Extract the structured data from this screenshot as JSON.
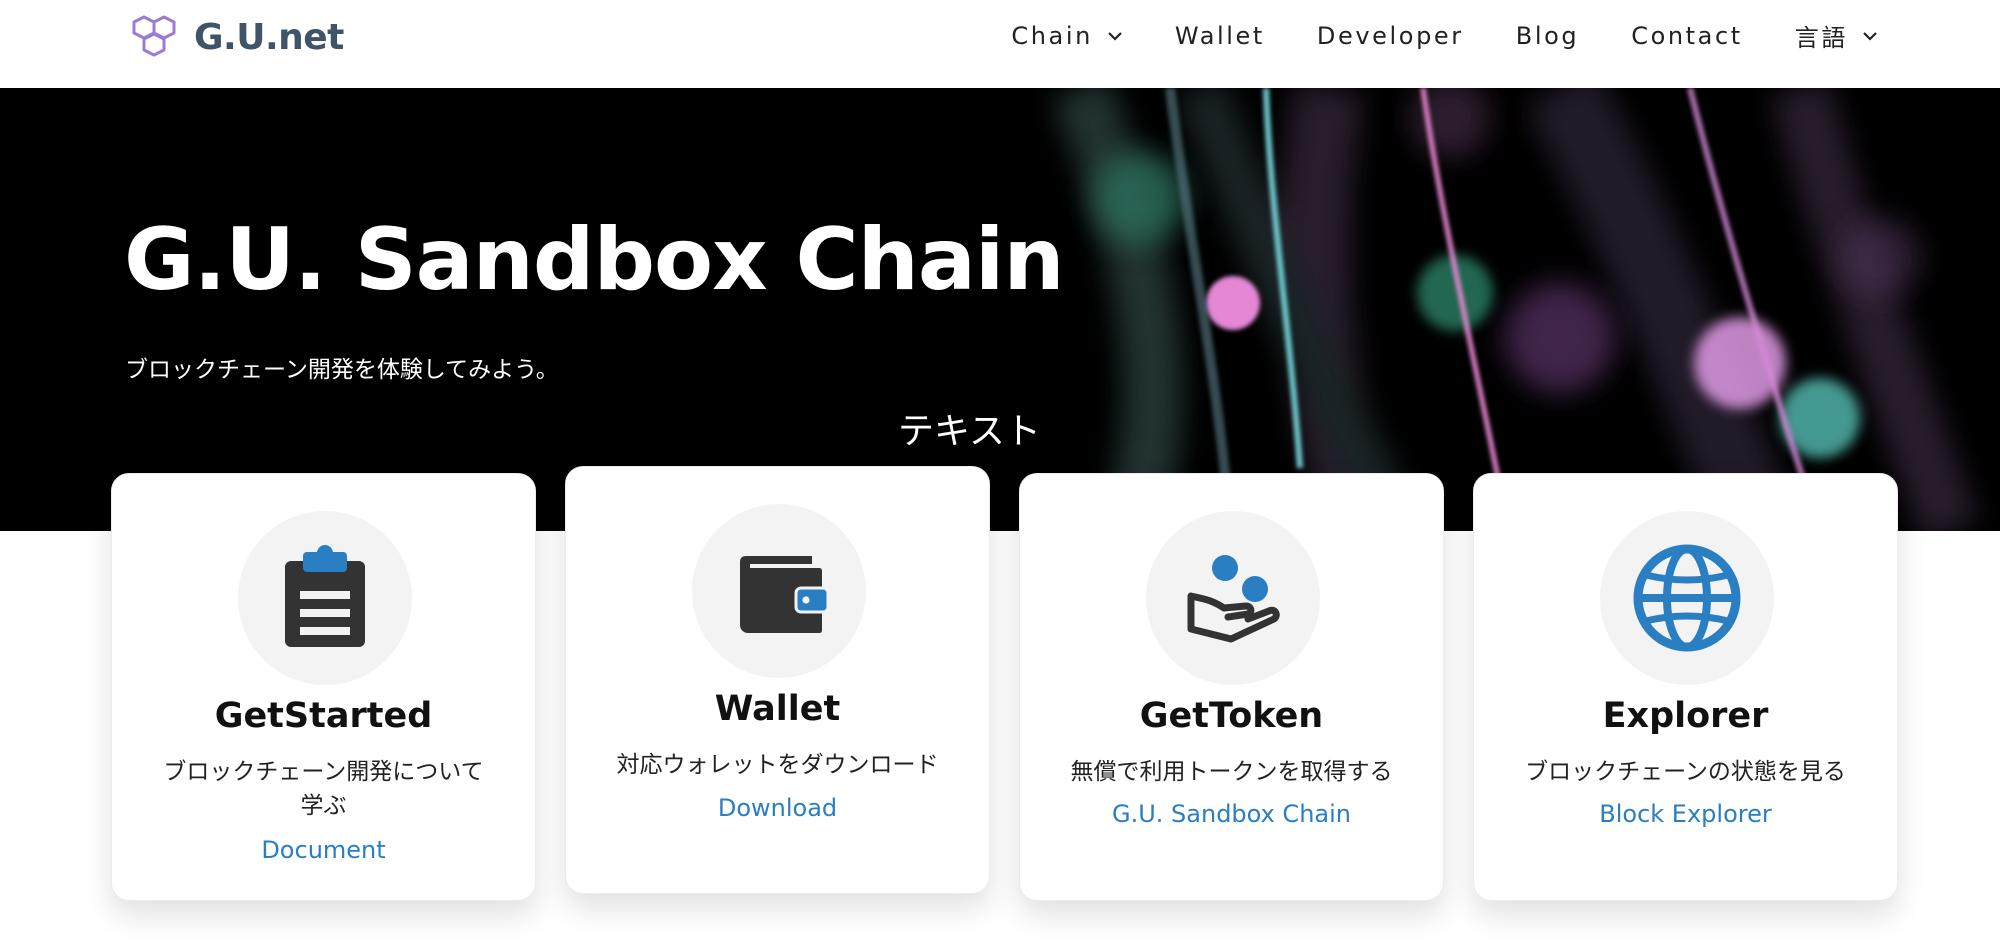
{
  "brand": {
    "name": "G.U.net",
    "color": "#3f5467",
    "accent": "#9a7bd8"
  },
  "nav": {
    "items": [
      {
        "label": "Chain",
        "dropdown": true
      },
      {
        "label": "Wallet",
        "dropdown": false
      },
      {
        "label": "Developer",
        "dropdown": false
      },
      {
        "label": "Blog",
        "dropdown": false
      },
      {
        "label": "Contact",
        "dropdown": false
      },
      {
        "label": "言語",
        "dropdown": true
      }
    ]
  },
  "hero": {
    "title": "G.U. Sandbox Chain",
    "subtitle": "ブロックチェーン開発を体験してみよう。",
    "caption": "テキスト"
  },
  "cards": [
    {
      "icon": "clipboard-icon",
      "title": "GetStarted",
      "description": "ブロックチェーン開発について学ぶ",
      "link": "Document"
    },
    {
      "icon": "wallet-icon",
      "title": "Wallet",
      "description": "対応ウォレットをダウンロード",
      "link": "Download"
    },
    {
      "icon": "hand-coins-icon",
      "title": "GetToken",
      "description": "無償で利用トークンを取得する",
      "link": "G.U. Sandbox Chain"
    },
    {
      "icon": "globe-icon",
      "title": "Explorer",
      "description": "ブロックチェーンの状態を見る",
      "link": "Block Explorer"
    }
  ],
  "colors": {
    "link": "#2a7ec2",
    "icon_dark": "#333333",
    "icon_blue": "#2a7ec2",
    "hero_bg": "#000000"
  }
}
